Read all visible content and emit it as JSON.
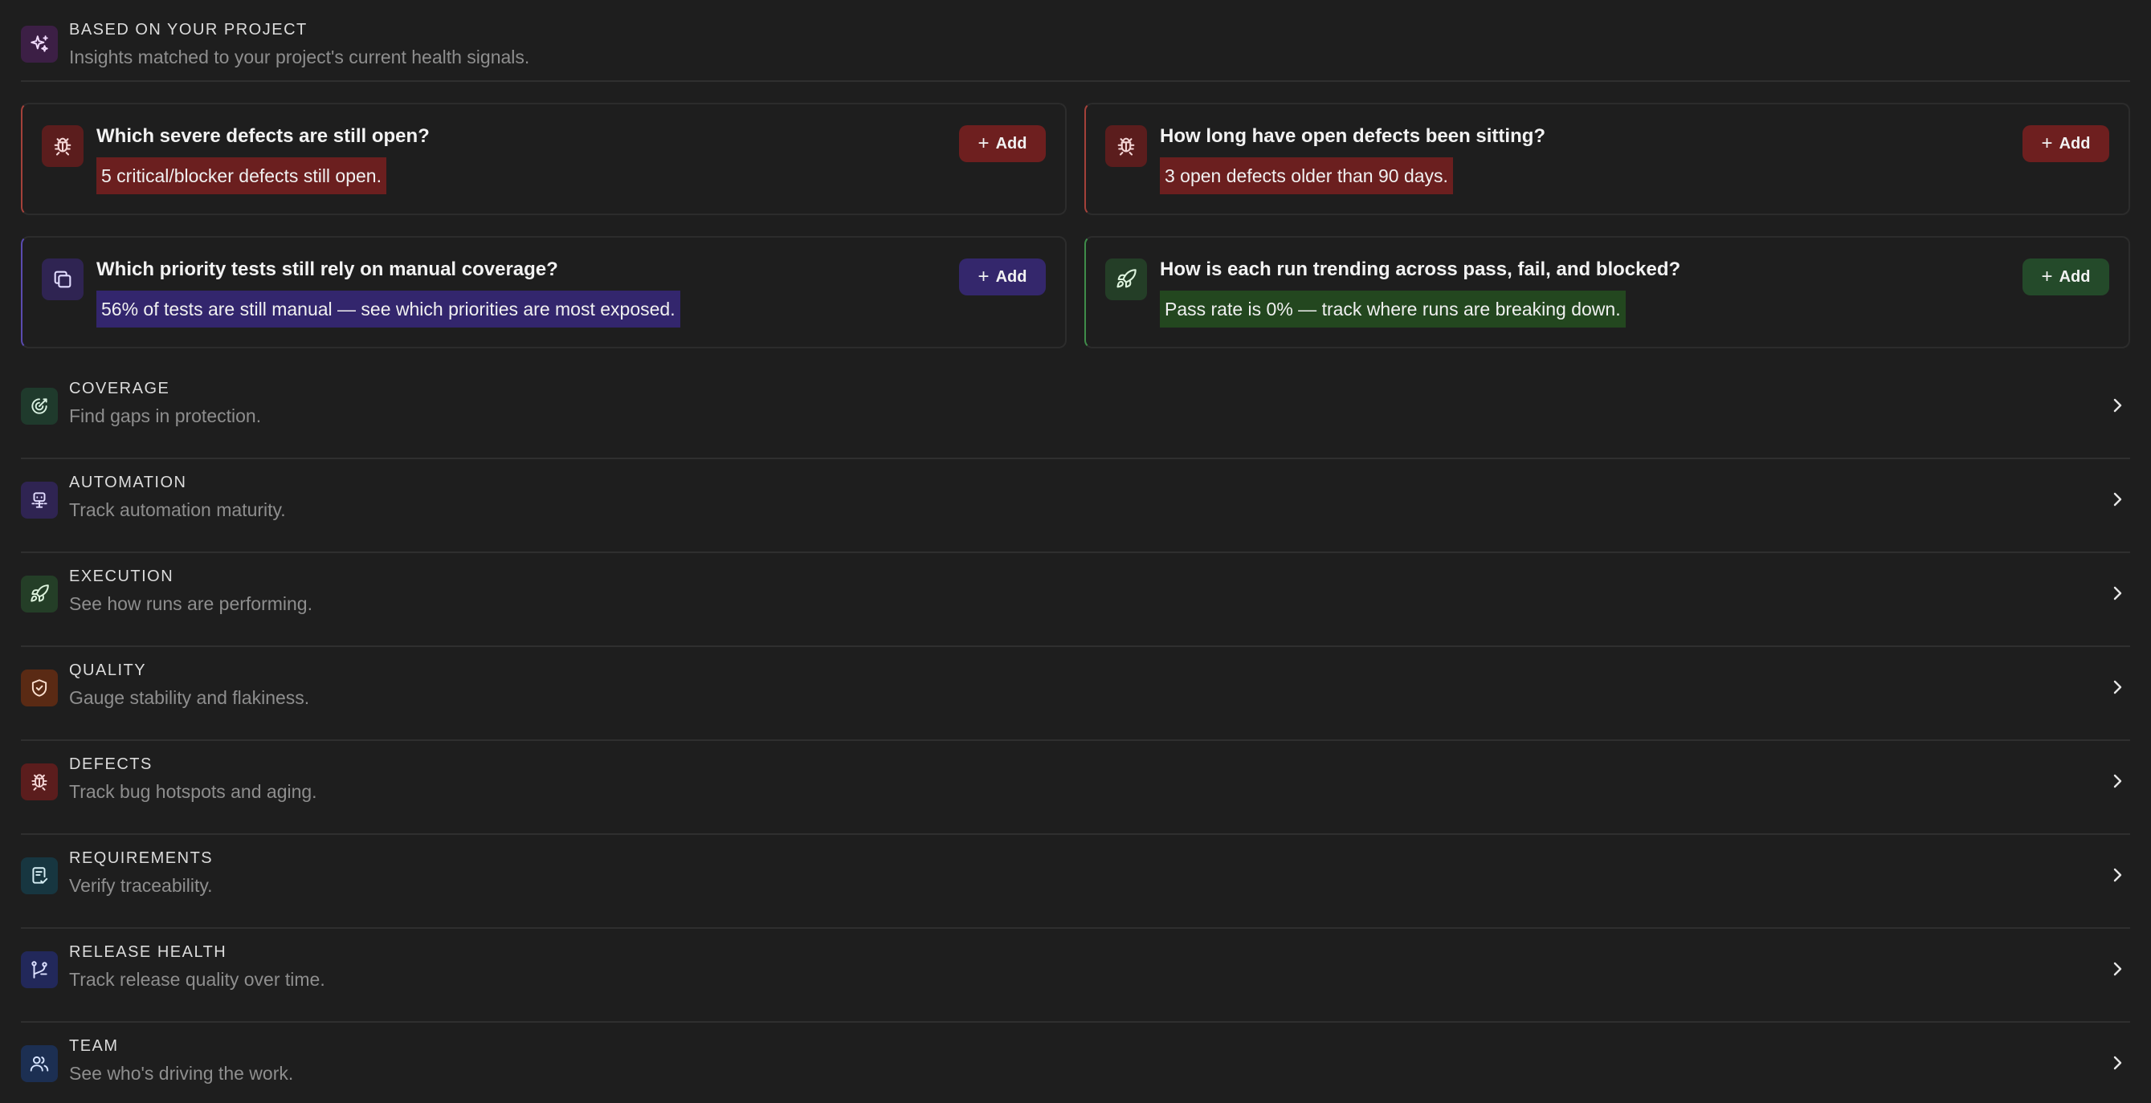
{
  "header": {
    "eyebrow": "BASED ON YOUR PROJECT",
    "subtitle": "Insights matched to your project's current health signals.",
    "icon": "sparkles-icon"
  },
  "insights": [
    {
      "title": "Which severe defects are still open?",
      "highlight": "5 critical/blocker defects still open.",
      "button": "Add",
      "icon": "bug-icon",
      "accent": "#6b1f1f"
    },
    {
      "title": "How long have open defects been sitting?",
      "highlight": "3 open defects older than 90 days.",
      "button": "Add",
      "icon": "bug-icon",
      "accent": "#6b1f1f"
    },
    {
      "title": "Which priority tests still rely on manual coverage?",
      "highlight": "56% of tests are still manual — see which priorities are most exposed.",
      "button": "Add",
      "icon": "copy-icon",
      "accent": "#33266d"
    },
    {
      "title": "How is each run trending across pass, fail, and blocked?",
      "highlight": "Pass rate is 0% — track where runs are breaking down.",
      "button": "Add",
      "icon": "rocket-icon",
      "accent": "#23471f"
    }
  ],
  "categories": [
    {
      "eyebrow": "COVERAGE",
      "subtitle": "Find gaps in protection.",
      "icon": "target-icon",
      "color": "#1f3a2c"
    },
    {
      "eyebrow": "AUTOMATION",
      "subtitle": "Track automation maturity.",
      "icon": "robot-icon",
      "color": "#2f2452"
    },
    {
      "eyebrow": "EXECUTION",
      "subtitle": "See how runs are performing.",
      "icon": "rocket-icon",
      "color": "#243e27"
    },
    {
      "eyebrow": "QUALITY",
      "subtitle": "Gauge stability and flakiness.",
      "icon": "shield-icon",
      "color": "#5a2a14"
    },
    {
      "eyebrow": "DEFECTS",
      "subtitle": "Track bug hotspots and aging.",
      "icon": "bug-icon",
      "color": "#5b1d1d"
    },
    {
      "eyebrow": "REQUIREMENTS",
      "subtitle": "Verify traceability.",
      "icon": "file-check-icon",
      "color": "#173640"
    },
    {
      "eyebrow": "RELEASE HEALTH",
      "subtitle": "Track release quality over time.",
      "icon": "git-branch-icon",
      "color": "#22285a"
    },
    {
      "eyebrow": "TEAM",
      "subtitle": "See who's driving the work.",
      "icon": "users-icon",
      "color": "#1c2f52"
    }
  ]
}
